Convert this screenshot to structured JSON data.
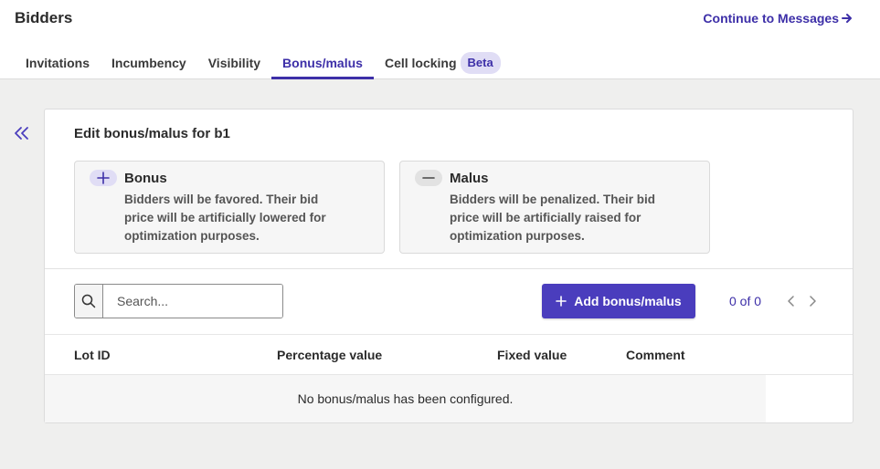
{
  "header": {
    "title": "Bidders",
    "continue_link": "Continue to Messages"
  },
  "tabs": [
    {
      "label": "Invitations",
      "active": false
    },
    {
      "label": "Incumbency",
      "active": false
    },
    {
      "label": "Visibility",
      "active": false
    },
    {
      "label": "Bonus/malus",
      "active": true
    },
    {
      "label": "Cell locking",
      "active": false,
      "badge": "Beta"
    }
  ],
  "sidebar": {
    "collapse_icon": "double-chevron-left-icon"
  },
  "panel": {
    "title": "Edit bonus/malus for b1",
    "bonus": {
      "icon": "plus-icon",
      "title": "Bonus",
      "description": "Bidders will be favored. Their bid price will be artificially lowered for optimization purposes."
    },
    "malus": {
      "icon": "minus-icon",
      "title": "Malus",
      "description": "Bidders will be penalized. Their bid price will be artificially raised for optimization purposes."
    },
    "search": {
      "placeholder": "Search...",
      "value": ""
    },
    "add_button": "Add bonus/malus",
    "pager": {
      "count": "0 of 0"
    },
    "table": {
      "columns": [
        "Lot ID",
        "Percentage value",
        "Fixed value",
        "Comment"
      ],
      "empty_message": "No bonus/malus has been configured."
    }
  },
  "colors": {
    "accent": "#4a3dbd",
    "accent_text": "#3d2fa8",
    "badge_bg": "#e0ddf5",
    "page_bg": "#efefee"
  }
}
